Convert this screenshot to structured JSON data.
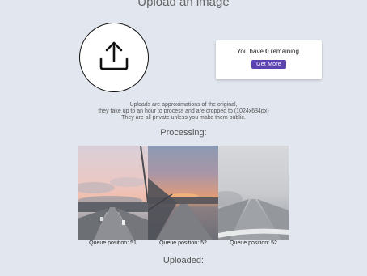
{
  "page": {
    "title": "Upload an image"
  },
  "quota": {
    "prefix": "You have ",
    "count": "0",
    "suffix": " remaining.",
    "button_label": "Get More"
  },
  "info": {
    "line1": "Uploads are approximations of the original,",
    "line2": "they take up to an hour to process and are cropped to (1024x634px)",
    "line3": "They are all private unless you make them public."
  },
  "processing": {
    "heading": "Processing:",
    "items": [
      {
        "queue_label": "Queue position: 51"
      },
      {
        "queue_label": "Queue position: 52"
      },
      {
        "queue_label": "Queue position: 52"
      }
    ]
  },
  "uploaded": {
    "heading": "Uploaded:"
  },
  "icons": {
    "upload": "upload-icon"
  },
  "colors": {
    "background": "#e2e6ee",
    "button": "#5b44b0"
  }
}
